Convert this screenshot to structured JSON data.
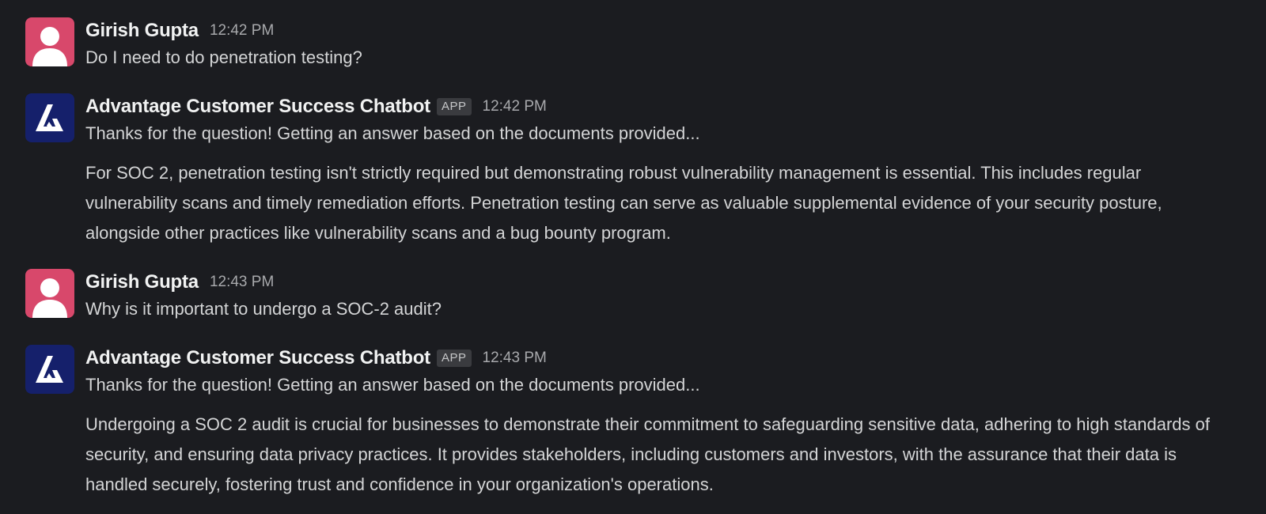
{
  "messages": [
    {
      "author": "Girish Gupta",
      "timestamp": "12:42 PM",
      "avatar": "user-avatar",
      "paragraphs": [
        "Do I need to do penetration testing?"
      ]
    },
    {
      "author": "Advantage Customer Success Chatbot",
      "badge": "APP",
      "timestamp": "12:42 PM",
      "avatar": "advantage-logo",
      "paragraphs": [
        "Thanks for the question! Getting an answer based on the documents provided...",
        "For SOC 2, penetration testing isn't strictly required but demonstrating robust vulnerability management is essential. This includes regular vulnerability scans and timely remediation efforts. Penetration testing can serve as valuable supplemental evidence of your security posture, alongside other practices like vulnerability scans and a bug bounty program."
      ]
    },
    {
      "author": "Girish Gupta",
      "timestamp": "12:43 PM",
      "avatar": "user-avatar",
      "paragraphs": [
        "Why is it important to undergo a SOC-2 audit?"
      ]
    },
    {
      "author": "Advantage Customer Success Chatbot",
      "badge": "APP",
      "timestamp": "12:43 PM",
      "avatar": "advantage-logo",
      "paragraphs": [
        "Thanks for the question! Getting an answer based on the documents provided...",
        "Undergoing a SOC 2 audit is crucial for businesses to demonstrate their commitment to safeguarding sensitive data, adhering to high standards of security, and ensuring data privacy practices. It provides stakeholders, including customers and investors, with the assurance that their data is handled securely, fostering trust and confidence in your organization's operations."
      ]
    }
  ],
  "colors": {
    "background": "#1b1c20",
    "user_avatar": "#d8486b",
    "bot_avatar": "#15206b",
    "author_text": "#f1f2f2",
    "body_text": "#d4d5d6"
  }
}
